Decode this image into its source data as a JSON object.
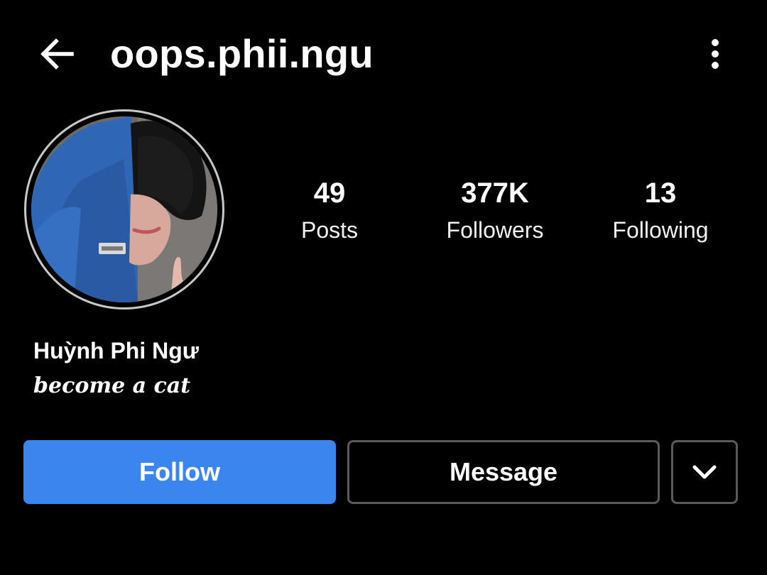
{
  "header": {
    "username": "oops.phii.ngu",
    "back_icon": "arrow-left-icon",
    "menu_icon": "more-vertical-icon"
  },
  "profile": {
    "avatar_description": "profile photo",
    "stats": {
      "posts": {
        "value": "49",
        "label": "Posts"
      },
      "followers": {
        "value": "377K",
        "label": "Followers"
      },
      "following": {
        "value": "13",
        "label": "Following"
      }
    },
    "display_name": "Huỳnh Phi Ngư",
    "bio": "become a cat"
  },
  "actions": {
    "follow_label": "Follow",
    "message_label": "Message",
    "more_icon": "chevron-down-icon"
  },
  "colors": {
    "background": "#000000",
    "follow_button": "#3a86ee",
    "outline": "#5a5a5a",
    "text": "#ffffff"
  }
}
